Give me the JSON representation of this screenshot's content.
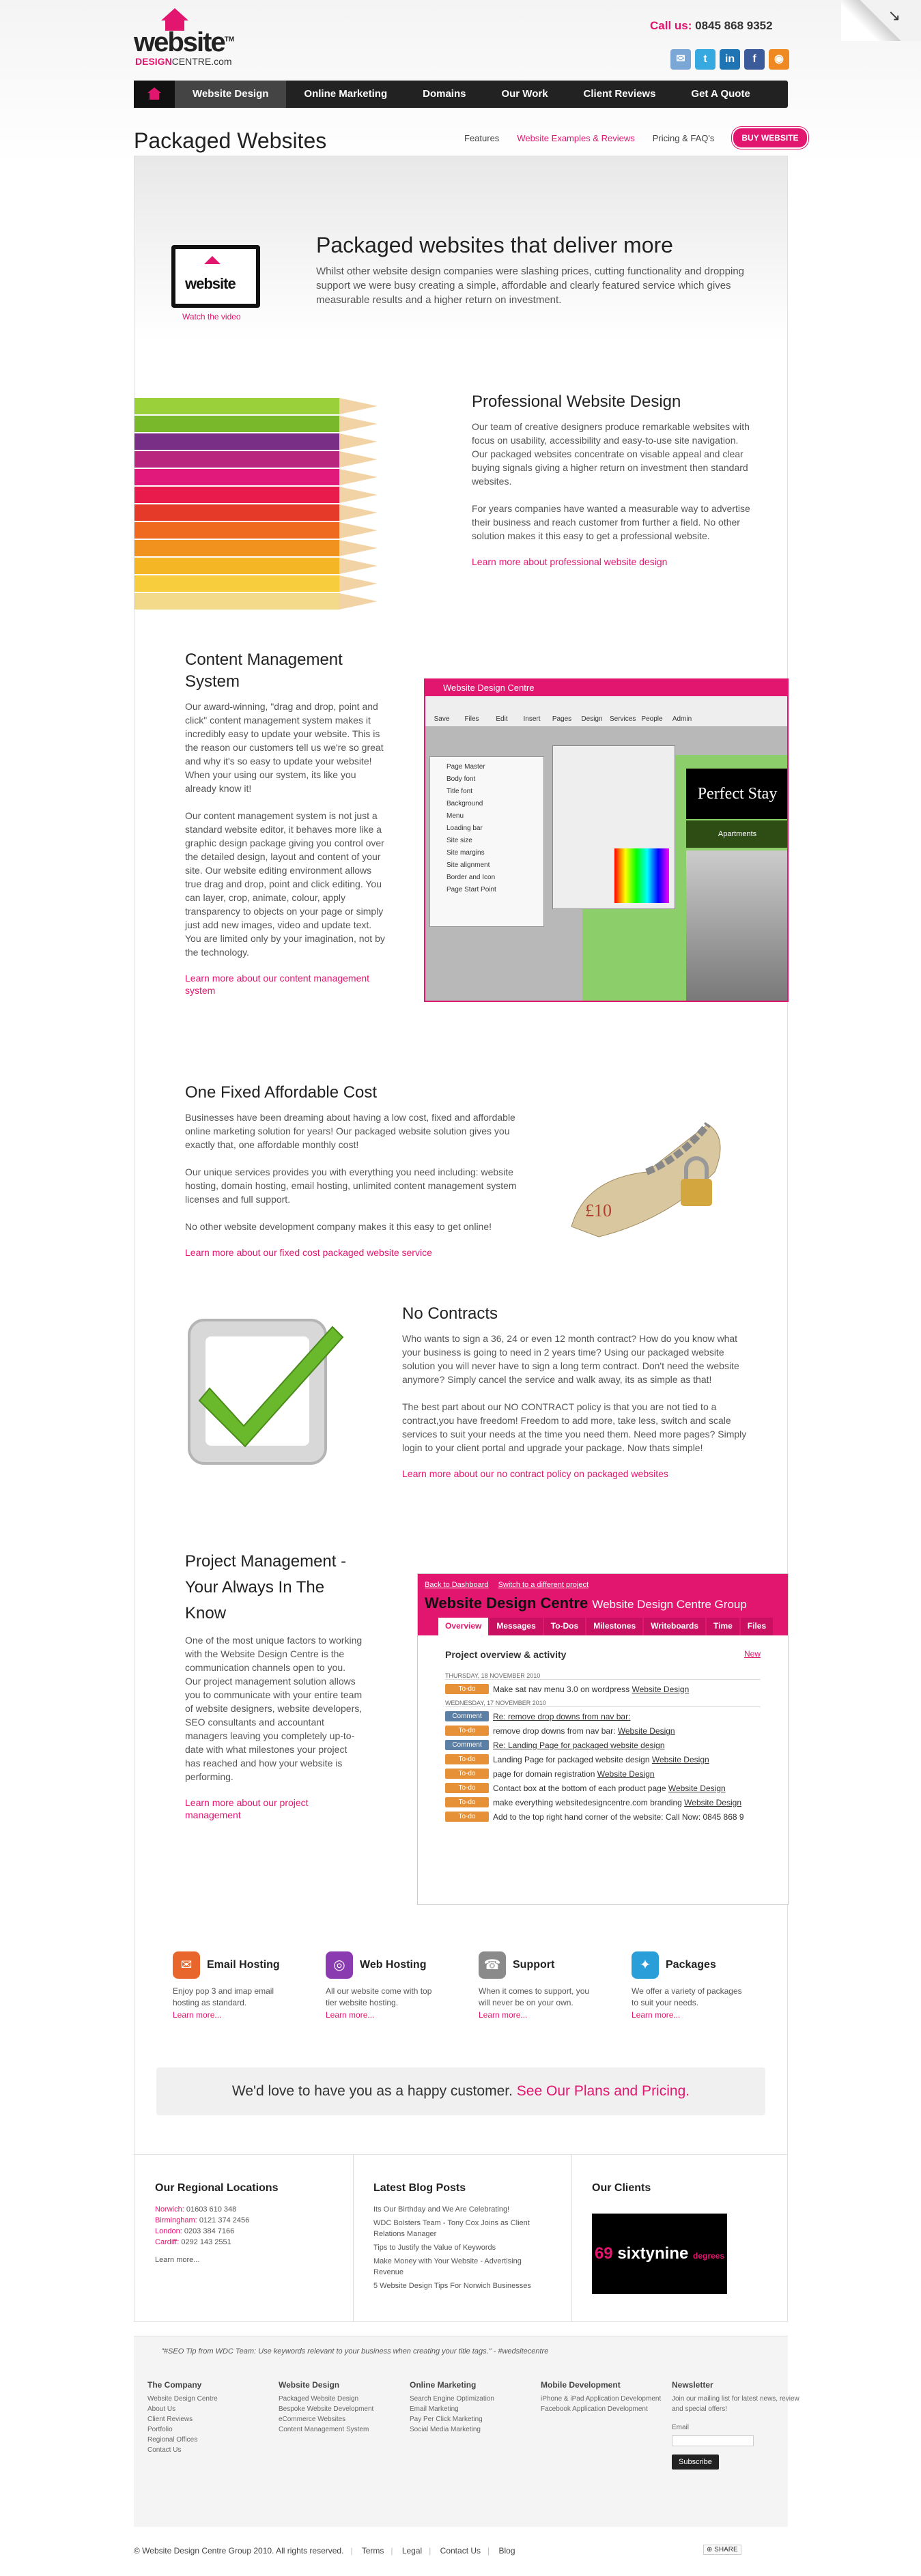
{
  "header": {
    "logo_word": "website",
    "logo_sub_a": "DESIGN",
    "logo_sub_b": "CENTRE.com",
    "phone_label": "Call us:",
    "phone_number": "0845 868 9352"
  },
  "nav": {
    "items": [
      "Website Design",
      "Online Marketing",
      "Domains",
      "Our Work",
      "Client Reviews",
      "Get A Quote"
    ]
  },
  "page": {
    "title": "Packaged Websites",
    "subnav": [
      "Features",
      "Website Examples & Reviews",
      "Pricing & FAQ's"
    ],
    "buy": "BUY WEBSITE"
  },
  "hero": {
    "tv_text": "website",
    "watch": "Watch the video",
    "heading": "Packaged websites that deliver more",
    "text": "Whilst other website design companies were slashing prices, cutting functionality and dropping support we were busy creating a simple, affordable and clearly featured service which gives measurable results and a higher return on investment."
  },
  "professional": {
    "heading": "Professional Website Design",
    "p1": "Our team of creative designers produce remarkable websites with focus on usability, accessibility and easy-to-use site navigation. Our packaged websites concentrate on visable appeal and clear buying signals giving a higher return on investment then standard websites.",
    "p2": "For years companies have wanted a measurable way to advertise their business and reach customer from further a field. No other solution makes it this easy to get a professional website.",
    "link": "Learn more about professional website design"
  },
  "cms_section": {
    "heading": "Content Management System",
    "p1": "Our award-winning, \"drag and drop, point and click\" content management system makes it incredibly easy to update your website. This is the reason our customers tell us we're so great and why it's so easy to update your website! When your using our system, its like you already know it!",
    "p2": "Our content management system is not just a standard website editor, it behaves more like a graphic design package giving you control over the detailed design, layout and content of your site. Our website editing environment allows true drag and drop, point and click editing. You can layer, crop, animate, colour, apply transparency to objects on your page or simply just add new images, video and update text. You are limited only by your imagination, not by the technology.",
    "link": "Learn more about our content management system",
    "shot": {
      "bar": "Website Design Centre",
      "tools": [
        "Save",
        "Files",
        "Edit",
        "Insert",
        "Pages",
        "Design",
        "Services",
        "People",
        "Admin"
      ],
      "menu": [
        "Page Master",
        "Body font",
        "Title font",
        "Background",
        "Menu",
        "Loading bar",
        "Site size",
        "Site margins",
        "Site alignment",
        "Border and Icon",
        "Page Start Point"
      ],
      "sign": "Perfect Stay",
      "apt": "Apartments"
    }
  },
  "fixed": {
    "heading": "One Fixed Affordable Cost",
    "p1": "Businesses have been dreaming about having a low cost, fixed and affordable online marketing solution for years! Our packaged website solution gives you exactly that, one affordable monthly cost!",
    "p2": "Our unique services provides you with everything you need including: website hosting, domain hosting, email hosting, unlimited content management system licenses and full support.",
    "p3": "No other website development company makes it this easy to get online!",
    "link": "Learn more about our fixed cost packaged website service"
  },
  "contracts": {
    "heading": "No Contracts",
    "p1": "Who wants to sign a 36, 24 or even 12 month contract? How do you know what your business is going to need in 2 years time? Using our packaged website solution you will never have to sign a long term contract. Don't need the website anymore? Simply cancel the service and walk away, its as simple as that!",
    "p2": "The best part about our NO CONTRACT policy is that you are not tied to a contract,you have freedom! Freedom to add more, take less, switch and scale services to suit your needs at the time you need them. Need more pages? Simply login to your client portal and upgrade your package. Now thats simple!",
    "link": "Learn more about our no contract policy on packaged websites"
  },
  "project": {
    "heading": "Project Management - Your Always In The Know",
    "p1": "One of the most unique factors to working with the Website Design Centre is the communication channels open to you. Our project management solution allows you to communicate with your entire team of website designers, website developers, SEO consultants and accountant managers leaving you completely up-to-date with what milestones your project has reached and how your website is performing.",
    "link": "Learn more about our project management",
    "shot": {
      "back": "Back to Dashboard",
      "switch": "Switch to a different project",
      "brand": "Website Design Centre",
      "group": "Website Design Centre Group",
      "tabs": [
        "Overview",
        "Messages",
        "To-Dos",
        "Milestones",
        "Writeboards",
        "Time",
        "Files"
      ],
      "new": "New",
      "title": "Project overview & activity",
      "date1": "THURSDAY, 18 NOVEMBER 2010",
      "date2": "WEDNESDAY, 17 NOVEMBER 2010",
      "rows1": [
        {
          "tag": "To-do",
          "text": "Make sat nav menu 3.0 on wordpress",
          "link": "Website Design"
        }
      ],
      "rows2": [
        {
          "tag": "Comment",
          "text": "",
          "link": "Re: remove drop downs from nav bar:"
        },
        {
          "tag": "To-do",
          "text": "remove drop downs from nav bar:",
          "link": "Website Design"
        },
        {
          "tag": "Comment",
          "text": "",
          "link": "Re: Landing Page for packaged website design"
        },
        {
          "tag": "To-do",
          "text": "Landing Page for packaged website design",
          "link": "Website Design"
        },
        {
          "tag": "To-do",
          "text": "page for domain registration",
          "link": "Website Design"
        },
        {
          "tag": "To-do",
          "text": "Contact box at the bottom of each product page",
          "link": "Website Design"
        },
        {
          "tag": "To-do",
          "text": "make everything websitedesigncentre.com branding",
          "link": "Website Design"
        },
        {
          "tag": "To-do",
          "text": "Add to the top right hand corner of the website: Call Now: 0845 868 9",
          "link": ""
        }
      ]
    }
  },
  "services": [
    {
      "title": "Email Hosting",
      "text": "Enjoy pop 3 and imap email hosting as standard.",
      "link": "Learn more...",
      "color": "#e8662c"
    },
    {
      "title": "Web Hosting",
      "text": "All our website come with top tier website hosting.",
      "link": "Learn more...",
      "color": "#8a3bb0"
    },
    {
      "title": "Support",
      "text": "When it comes to support, you will never be on your own.",
      "link": "Learn more...",
      "color": "#8a8a8a"
    },
    {
      "title": "Packages",
      "text": "We offer a variety of packages to suit your needs.",
      "link": "Learn more...",
      "color": "#2a9ed8"
    }
  ],
  "happy": {
    "text": "We'd love to have you as a happy customer.",
    "link": "See Our Plans and Pricing."
  },
  "regional": {
    "heading": "Our Regional Locations",
    "lines": [
      {
        "city": "Norwich:",
        "tel": "01603 610 348"
      },
      {
        "city": "Birmingham:",
        "tel": "0121 374 2456"
      },
      {
        "city": "London:",
        "tel": "0203 384 7166"
      },
      {
        "city": "Cardiff:",
        "tel": "0292 143 2551"
      }
    ],
    "link": "Learn more..."
  },
  "blog": {
    "heading": "Latest Blog Posts",
    "posts": [
      "Its Our Birthday and We Are Celebrating!",
      "WDC Bolsters Team - Tony Cox Joins as Client Relations Manager",
      "Tips to Justify the Value of Keywords",
      "Make Money with Your Website - Advertising Revenue",
      "5 Website Design Tips For Norwich Businesses"
    ]
  },
  "clients": {
    "heading": "Our Clients",
    "logo_a": "69",
    "logo_b": "sixtynine",
    "logo_c": "degrees"
  },
  "tweet": "\"#SEO Tip from WDC Team: Use keywords relevant to your business when creating your title tags.\" - #wedsitecentre",
  "footer_cols": [
    {
      "title": "The Company",
      "links": [
        "Website Design Centre",
        "About Us",
        "Client Reviews",
        "Portfolio",
        "Regional Offices",
        "Contact Us"
      ]
    },
    {
      "title": "Website Design",
      "links": [
        "Packaged Website Design",
        "Bespoke Website Development",
        "eCommerce Websites",
        "Content Management System"
      ]
    },
    {
      "title": "Online Marketing",
      "links": [
        "Search Engine Optimization",
        "Email Marketing",
        "Pay Per Click Marketing",
        "Social Media Marketing"
      ]
    },
    {
      "title": "Mobile Development",
      "links": [
        "iPhone & iPad Application Development",
        "Facebook Application Development"
      ]
    }
  ],
  "newsletter": {
    "title": "Newsletter",
    "text": "Join our mailing list for latest news, review and special offers!",
    "label": "Email",
    "button": "Subscribe"
  },
  "copyright": {
    "text": "© Website Design Centre Group 2010. All rights reserved.",
    "links": [
      "Terms",
      "Legal",
      "Contact Us",
      "Blog"
    ]
  },
  "share": "SHARE"
}
